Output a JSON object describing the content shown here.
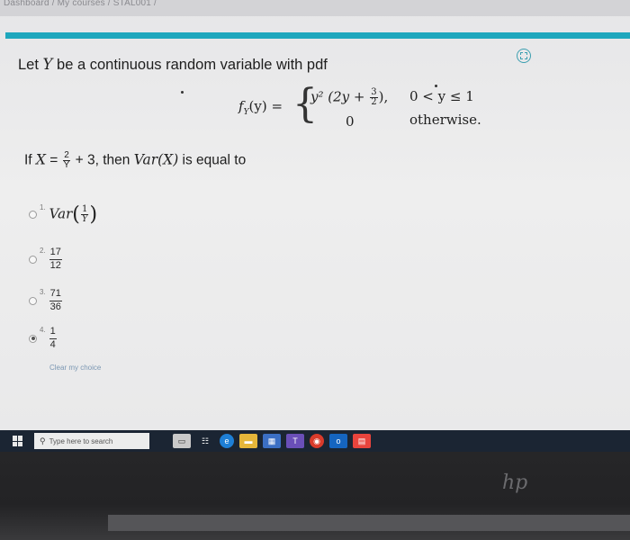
{
  "breadcrumb": "Dashboard / My courses / STAL001 /",
  "question": {
    "intro_prefix": "Let ",
    "intro_var": "Y",
    "intro_suffix": " be a continuous random variable with pdf",
    "pdf": {
      "lhs": "f",
      "lhs_sub": "Y",
      "lhs_arg": "(y) =",
      "case1_expr": "y² (2y + ",
      "case1_frac_num": "3",
      "case1_frac_den": "2",
      "case1_close": "),",
      "case1_condition": "0 < y ≤ 1",
      "case2_expr": "0",
      "case2_condition": "otherwise."
    },
    "if_prefix": "If ",
    "if_var": "X",
    "if_eq": " = ",
    "if_frac_num": "2",
    "if_frac_den": "Y",
    "if_plus": " + 3, then ",
    "if_var_expr": "Var(X)",
    "if_suffix": " is equal to"
  },
  "options": [
    {
      "number": "1.",
      "text": "Var",
      "frac_num": "1",
      "frac_den": "Y",
      "checked": false
    },
    {
      "number": "2.",
      "frac_num": "17",
      "frac_den": "12",
      "checked": false
    },
    {
      "number": "3.",
      "frac_num": "71",
      "frac_den": "36",
      "checked": false
    },
    {
      "number": "4.",
      "frac_num": "1",
      "frac_den": "4",
      "checked": true
    }
  ],
  "clear_choice": "Clear my choice",
  "taskbar": {
    "search_placeholder": "Type here to search"
  },
  "brand": "hp",
  "colors": {
    "accent_bar": "#1fa7bd",
    "taskbar": "#1b2533"
  }
}
